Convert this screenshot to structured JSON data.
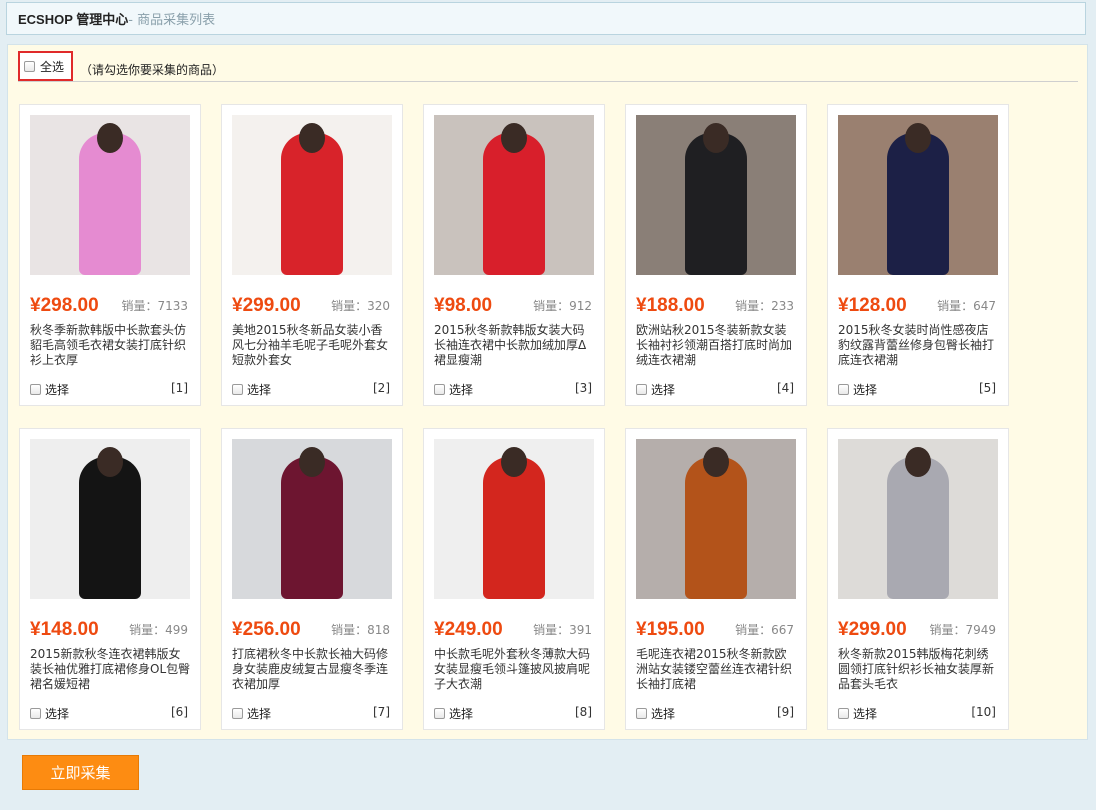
{
  "header": {
    "brand": "ECSHOP 管理中心",
    "subtitle": "- 商品采集列表"
  },
  "select_all": {
    "label": "全选",
    "hint": "（请勾选你要采集的商品）"
  },
  "sales_label": "销量：",
  "pick_label": "选择",
  "submit_label": "立即采集",
  "products": [
    {
      "price": "¥298.00",
      "sales": "7133",
      "title": "秋冬季新款韩版中长款套头仿貂毛高领毛衣裙女装打底针织衫上衣厚",
      "num": "[1]",
      "bg": "#e9e4e4",
      "dress": "#e58bd1"
    },
    {
      "price": "¥299.00",
      "sales": "320",
      "title": "美地2015秋冬新品女装小香风七分袖羊毛呢子毛呢外套女短款外套女",
      "num": "[2]",
      "bg": "#f4f1ee",
      "dress": "#d8232a"
    },
    {
      "price": "¥98.00",
      "sales": "912",
      "title": "2015秋冬新款韩版女装大码长袖连衣裙中长款加绒加厚Δ裙显瘦潮",
      "num": "[3]",
      "bg": "#c9c2bd",
      "dress": "#d81f2b"
    },
    {
      "price": "¥188.00",
      "sales": "233",
      "title": "欧洲站秋2015冬装新款女装长袖衬衫领潮百搭打底时尚加绒连衣裙潮",
      "num": "[4]",
      "bg": "#8a7f77",
      "dress": "#1f1f22"
    },
    {
      "price": "¥128.00",
      "sales": "647",
      "title": "2015秋冬女装时尚性感夜店豹纹露背蕾丝修身包臀长袖打底连衣裙潮",
      "num": "[5]",
      "bg": "#9a8070",
      "dress": "#1c2046"
    },
    {
      "price": "¥148.00",
      "sales": "499",
      "title": "2015新款秋冬连衣裙韩版女装长袖优雅打底裙修身OL包臀裙名媛短裙",
      "num": "[6]",
      "bg": "#eeeeee",
      "dress": "#141414"
    },
    {
      "price": "¥256.00",
      "sales": "818",
      "title": "打底裙秋冬中长款长袖大码修身女装鹿皮绒复古显瘦冬季连衣裙加厚",
      "num": "[7]",
      "bg": "#d7d9dc",
      "dress": "#6d1530"
    },
    {
      "price": "¥249.00",
      "sales": "391",
      "title": "中长款毛呢外套秋冬薄款大码女装显瘦毛领斗篷披风披肩呢子大衣潮",
      "num": "[8]",
      "bg": "#efefef",
      "dress": "#d3261e"
    },
    {
      "price": "¥195.00",
      "sales": "667",
      "title": "毛呢连衣裙2015秋冬新款欧洲站女装镂空蕾丝连衣裙针织长袖打底裙",
      "num": "[9]",
      "bg": "#b5aeab",
      "dress": "#b3531a"
    },
    {
      "price": "¥299.00",
      "sales": "7949",
      "title": "秋冬新款2015韩版梅花刺绣圆领打底针织衫长袖女装厚新品套头毛衣",
      "num": "[10]",
      "bg": "#dddbd8",
      "dress": "#a9a9b1"
    }
  ]
}
